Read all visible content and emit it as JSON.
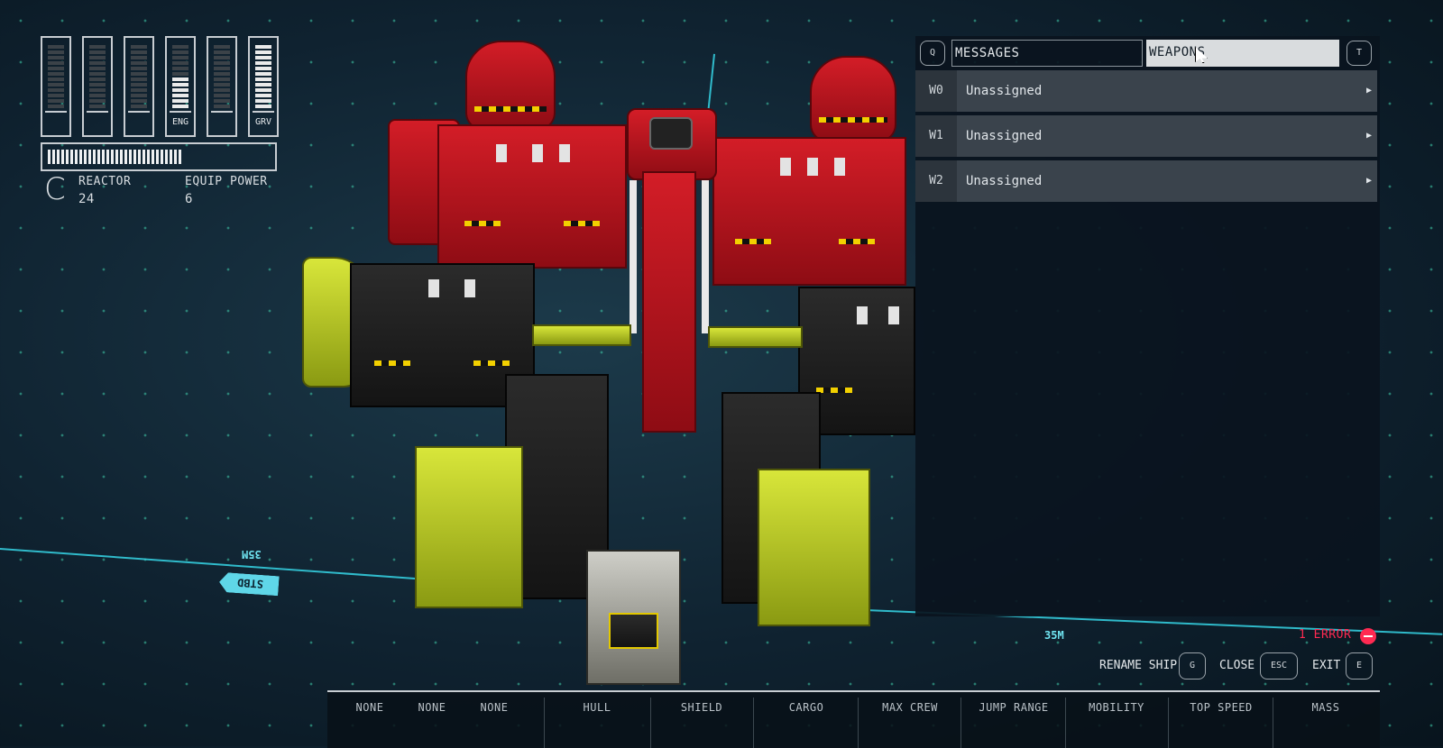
{
  "power": {
    "bars": [
      {
        "label": "",
        "level": 0
      },
      {
        "label": "",
        "level": 0
      },
      {
        "label": "",
        "level": 0
      },
      {
        "label": "ENG",
        "level": 0.5
      },
      {
        "label": "",
        "level": 0
      },
      {
        "label": "GRV",
        "level": 1.0
      }
    ],
    "reactor_usage": 0.6,
    "class_letter": "C",
    "reactor_label": "REACTOR",
    "reactor_value": "24",
    "equip_label": "EQUIP POWER",
    "equip_value": "6"
  },
  "panel": {
    "left_key": "Q",
    "right_key": "T",
    "tabs": {
      "messages": "MESSAGES",
      "weapons": "WEAPONS"
    },
    "weapons": [
      {
        "id": "W0",
        "name": "Unassigned"
      },
      {
        "id": "W1",
        "name": "Unassigned"
      },
      {
        "id": "W2",
        "name": "Unassigned"
      }
    ]
  },
  "viewport": {
    "dist_left": "35M",
    "dist_right": "35M",
    "stbd_label": "STBD"
  },
  "status": {
    "error": "1 ERROR"
  },
  "commands": {
    "rename": {
      "label": "RENAME SHIP",
      "key": "G"
    },
    "close": {
      "label": "CLOSE",
      "key": "ESC"
    },
    "exit": {
      "label": "EXIT",
      "key": "E"
    }
  },
  "stats": {
    "none1": "NONE",
    "none2": "NONE",
    "none3": "NONE",
    "hull": "HULL",
    "shield": "SHIELD",
    "cargo": "CARGO",
    "max_crew": "MAX CREW",
    "jump_range": "JUMP RANGE",
    "mobility": "MOBILITY",
    "top_speed": "TOP SPEED",
    "mass": "MASS"
  },
  "colors": {
    "accent_error": "#ff2a52",
    "guide_line": "#36d6e6",
    "ship_red": "#d31d27",
    "ship_yellow": "#d8e63a"
  }
}
